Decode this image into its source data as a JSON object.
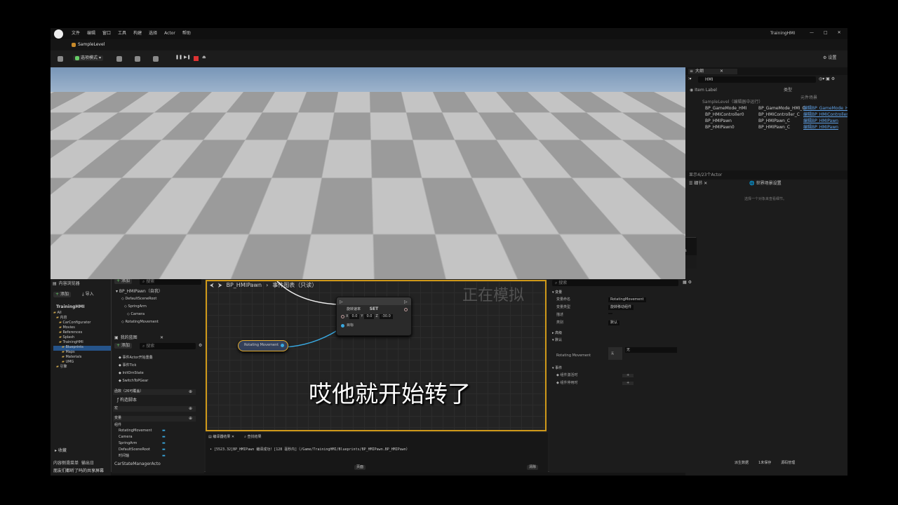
{
  "main_menu": [
    "文件",
    "编辑",
    "窗口",
    "工具",
    "构建",
    "选择",
    "Actor",
    "帮助"
  ],
  "project_name": "TrainingHMI",
  "level_tab": "SampleLevel",
  "main_toolbar": {
    "mode": "选项模式",
    "settings": "设置"
  },
  "outliner": {
    "tab": "大纲",
    "search_value": "HMI",
    "col_label": "Item Label",
    "col_type": "类型",
    "col_extra": "元件场景",
    "rows": [
      {
        "label": "SampleLevel（编辑器中运行）",
        "type": "",
        "link": ""
      },
      {
        "label": "BP_GameMode_HMI",
        "type": "BP_GameMode_HMI_C",
        "link": "编辑BP_GameMode_H"
      },
      {
        "label": "BP_HMIController0",
        "type": "BP_HMIController_C",
        "link": "编辑BP_HMIController"
      },
      {
        "label": "BP_HMIPawn",
        "type": "BP_HMIPawn_C",
        "link": "编辑BP_HMIPawn"
      },
      {
        "label": "BP_HMIPawn0",
        "type": "BP_HMIPawn_C",
        "link": "编辑BP_HMIPawn"
      }
    ],
    "footer": "显示4/23个Actor"
  },
  "right_details": {
    "tab1": "细节",
    "tab2": "世界场景设置",
    "empty": "选择一个对象来查看细节。"
  },
  "content_browser": {
    "tab": "内容浏览器",
    "add": "添加",
    "import": "导入",
    "root": "TrainingHMI",
    "tree": [
      "All",
      "内容",
      "CarConfigurator",
      "Movies",
      "References",
      "Splash",
      "TrainingHMI",
      "Blueprints",
      "Maps",
      "Materials",
      "UMG",
      "引擎"
    ],
    "collections": "收藏",
    "bottom_tabs": [
      "内容侧滑菜单",
      "输出日"
    ]
  },
  "bp": {
    "menu": [
      "文件",
      "编辑",
      "资产",
      "查看",
      "调试",
      "窗口",
      "工具",
      "帮助"
    ],
    "tabs": [
      "BP_HMIPawn",
      "BP_HMIController",
      "M_PPDissolve",
      "WBP_HMI",
      "BP_CarStateManager"
    ],
    "parent_label": "父类",
    "parent_value": "Pawn",
    "toolbar": [
      "编译",
      "对比",
      "查找",
      "隐藏不相关",
      "类设置",
      "类默认值",
      "模拟"
    ],
    "debug_target": "BP_HMIPawn",
    "components": {
      "tab": "组件",
      "add": "添加",
      "search": "搜索",
      "root": "BP_HMIPawn（自我）",
      "items": [
        "DefaultSceneRoot",
        "SpringArm",
        "Camera",
        "RotatingMovement"
      ]
    },
    "myblueprint": {
      "tab": "我的蓝图",
      "add": "添加",
      "search": "搜索",
      "events": [
        "事件Actor开始重叠",
        "事件Tick",
        "InitOrnState",
        "SwitchToPGear"
      ],
      "sections": [
        "函数（26可覆盖）",
        "构造脚本",
        "宏",
        "变量",
        "组件"
      ],
      "vars": [
        "RotatingMovement",
        "Camera",
        "SpringArm",
        "DefaultSceneRoot",
        "时间轴"
      ],
      "bottom": "CarStateManagerActo"
    },
    "graph_tabs": [
      "视口",
      "Construction Scr...",
      "事件图表",
      "时间轴_Template"
    ],
    "breadcrumb": [
      "BP_HMIPawn",
      "事件图表（只读）"
    ],
    "watermark": "正在模拟",
    "set_node": {
      "title": "SET",
      "field": "旋转速率",
      "x": "0.0",
      "y": "0.0",
      "z": "-30.0",
      "target": "目标"
    },
    "var_node": "Rotating Movement",
    "details": {
      "tab": "细节",
      "search": "搜索",
      "sections": [
        "变量",
        "默认",
        "事件"
      ],
      "rows": [
        {
          "k": "变量命名",
          "v": "RotatingMovement"
        },
        {
          "k": "变量类型",
          "v": "旋转移动组件"
        },
        {
          "k": "描述",
          "v": ""
        },
        {
          "k": "类别",
          "v": "默认"
        }
      ],
      "default_row": "Rotating Movement",
      "default_val": "无",
      "events": [
        "组件激活时",
        "组件停用时"
      ]
    },
    "log": {
      "tab1": "编译器结果",
      "tab2": "查找结果",
      "line": "[5523.32]BP_HMIPawn 编译成功！[128 毫秒内]（/Game/TrainingHMI/Blueprints/BP_HMIPawn.BP_HMIPawn）",
      "page": "页面",
      "clear": "清除"
    },
    "status": [
      "派生数据",
      "1未保存",
      "源码管理"
    ]
  },
  "share_notice": "朋友们都听了吗的共享屏幕",
  "subtitle": "哎他就开始转了"
}
